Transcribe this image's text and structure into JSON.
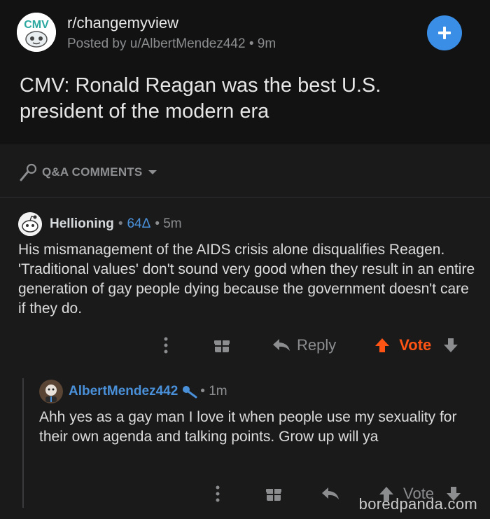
{
  "post": {
    "subreddit": "r/changemyview",
    "posted_by": "Posted by u/AlbertMendez442 • 9m",
    "title": "CMV: Ronald Reagan was the best U.S. president of the modern era",
    "avatar_text": "CMV",
    "plus_icon": "plus-icon"
  },
  "comments_bar": {
    "label": "Q&A COMMENTS"
  },
  "comment1": {
    "user": "Hellioning",
    "dot": "•",
    "delta": "64Δ",
    "time": "• 5m",
    "body": "His mismanagement of the AIDS crisis alone disqualifies Reagen. 'Traditional values' don't sound very good when they result in an entire generation of gay people dying because the government doesn't care if they do.",
    "actions": {
      "reply": "Reply",
      "vote": "Vote"
    }
  },
  "comment2": {
    "user": "AlbertMendez442",
    "time": "• 1m",
    "body": "Ahh yes as a gay man I love it when people use my sexuality for their own agenda and talking points. Grow up will ya",
    "actions": {
      "vote": "Vote"
    }
  },
  "watermark": "boredpanda.com",
  "colors": {
    "background": "#1a1a1b",
    "header": "#121212",
    "accent_blue": "#4a90d9",
    "upvote_orange": "#ff5414"
  }
}
